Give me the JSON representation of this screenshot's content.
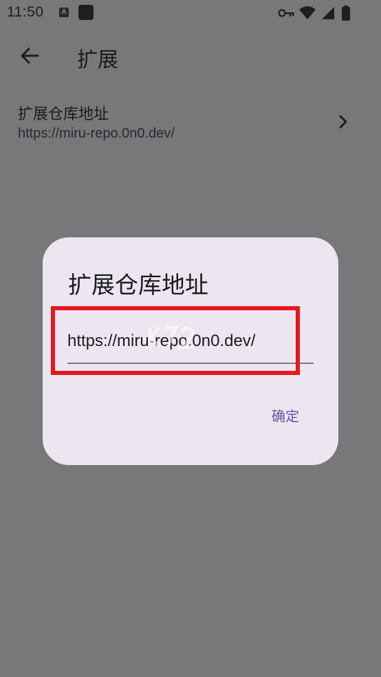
{
  "status_bar": {
    "time": "11:50",
    "notification_icon_letter": "A",
    "icons": [
      "key-icon",
      "wifi-icon",
      "signal-icon",
      "battery-icon"
    ]
  },
  "app_bar": {
    "title": "扩展",
    "back_icon": "arrow-left-icon"
  },
  "settings": {
    "repo_item": {
      "title": "扩展仓库地址",
      "subtitle": "https://miru-repo.0n0.dev/",
      "chevron_icon": "chevron-right-icon"
    }
  },
  "dialog": {
    "title": "扩展仓库地址",
    "input_value": "https://miru-repo.0n0.dev/",
    "confirm_label": "确定"
  },
  "colors": {
    "scrim_background": "#797779",
    "dialog_surface": "#ece6f1",
    "primary_text_button": "#6750a4",
    "highlight_annotation": "#e5181e"
  }
}
